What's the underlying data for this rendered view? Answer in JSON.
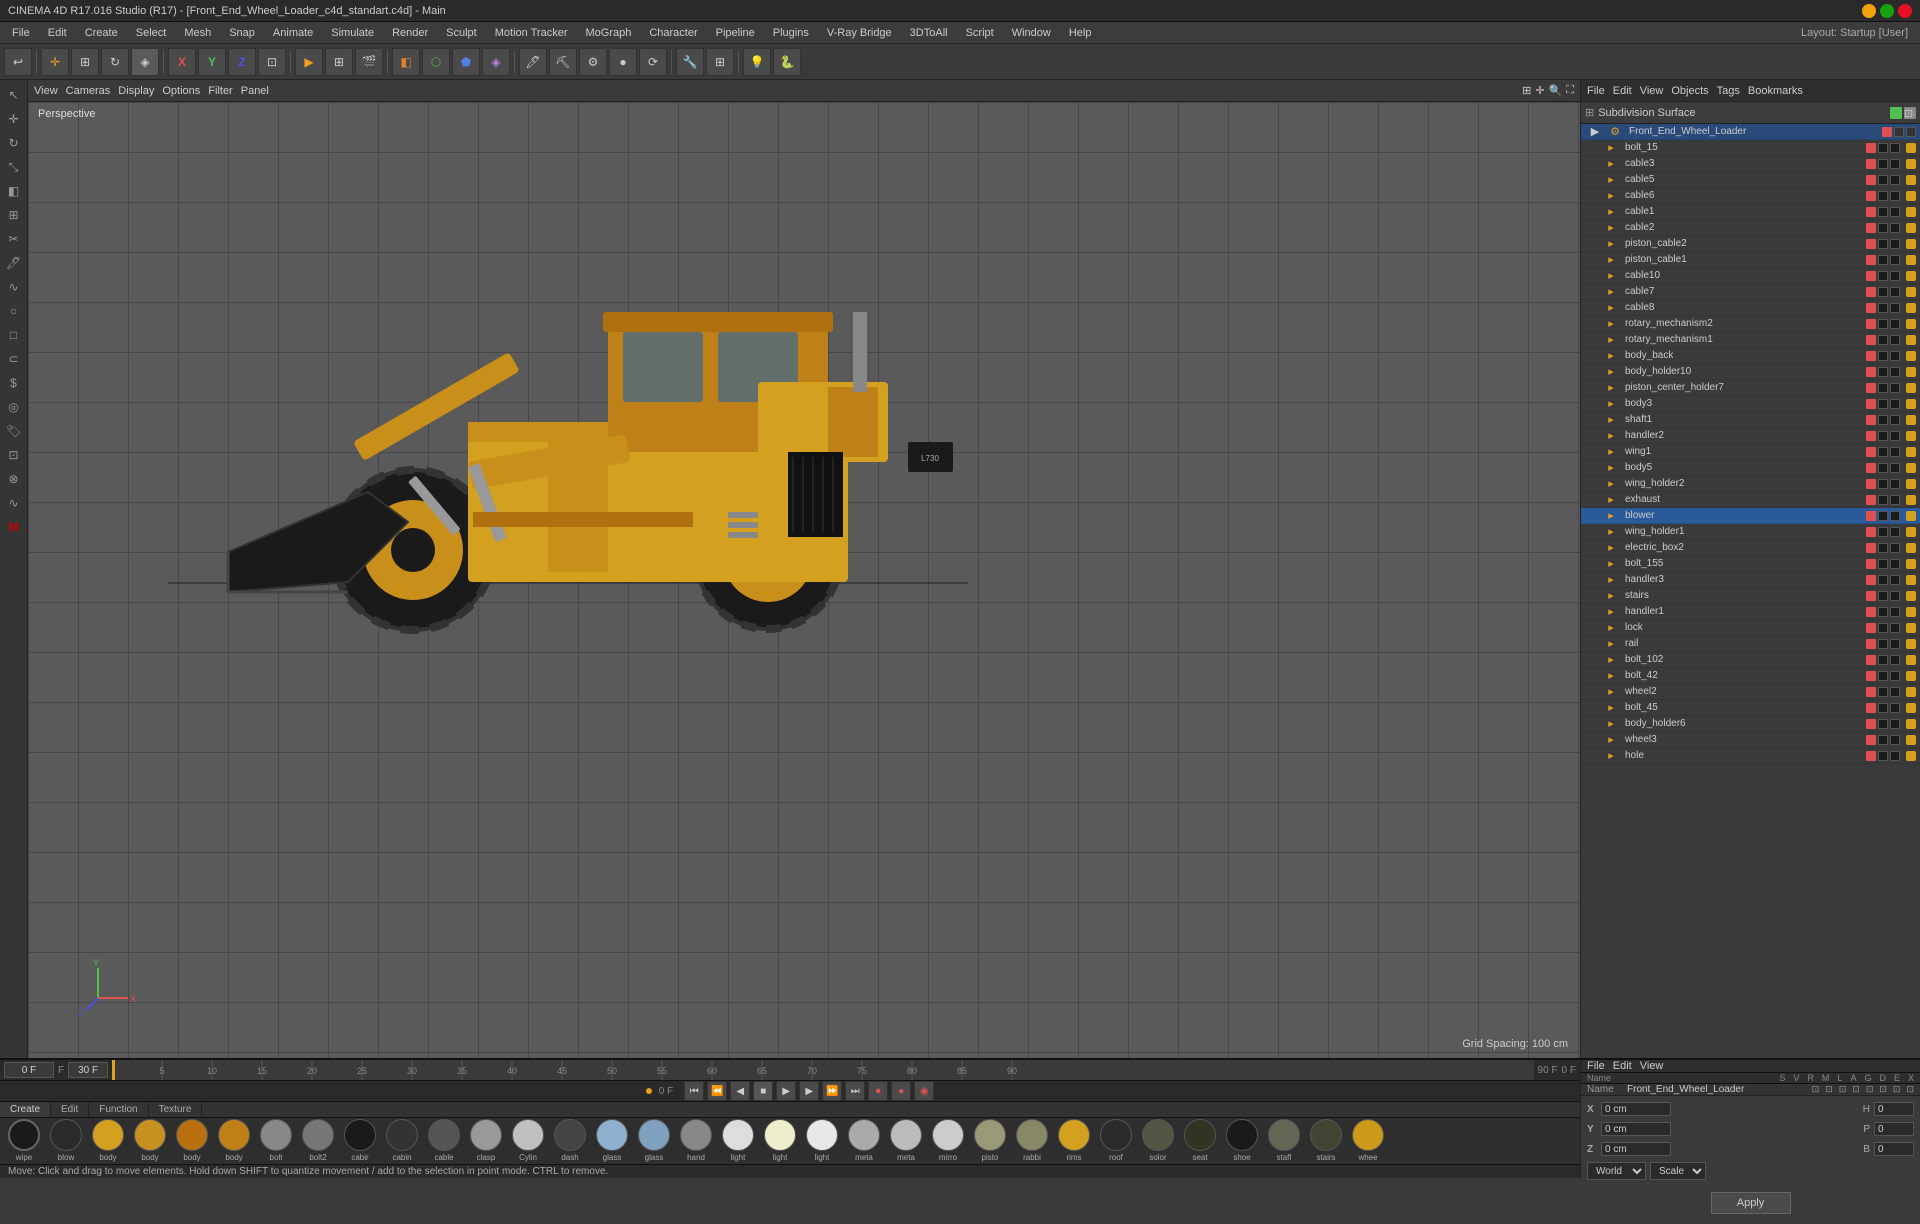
{
  "title_bar": {
    "title": "CINEMA 4D R17.016 Studio (R17) - [Front_End_Wheel_Loader_c4d_standart.c4d] - Main",
    "layout_label": "Layout: Startup [User]"
  },
  "menu_bar": {
    "items": [
      "File",
      "Edit",
      "Create",
      "Select",
      "Mesh",
      "Snap",
      "Animate",
      "Simulate",
      "Render",
      "Sculpt",
      "Motion Tracker",
      "MoGraph",
      "Character",
      "Pipeline",
      "Plugins",
      "V-Ray Bridge",
      "3DToAll",
      "Script",
      "Window",
      "Help"
    ]
  },
  "viewport": {
    "perspective_label": "Perspective",
    "grid_spacing": "Grid Spacing: 100 cm",
    "view_menus": [
      "View",
      "Cameras",
      "Display",
      "Options",
      "Filter",
      "Panel"
    ],
    "corner_icons": [
      "expand",
      "move",
      "zoom",
      "rotate"
    ]
  },
  "object_manager": {
    "header_menus": [
      "File",
      "Edit",
      "View",
      "Objects",
      "Tags",
      "Bookmarks"
    ],
    "subdivision_label": "Subdivision Surface",
    "root_object": "Front_End_Wheel_Loader",
    "objects": [
      {
        "name": "bolt_15",
        "indent": 1
      },
      {
        "name": "cable3",
        "indent": 1
      },
      {
        "name": "cable5",
        "indent": 1
      },
      {
        "name": "cable6",
        "indent": 1
      },
      {
        "name": "cable1",
        "indent": 1
      },
      {
        "name": "cable2",
        "indent": 1
      },
      {
        "name": "piston_cable2",
        "indent": 1
      },
      {
        "name": "piston_cable1",
        "indent": 1
      },
      {
        "name": "cable10",
        "indent": 1
      },
      {
        "name": "cable7",
        "indent": 1
      },
      {
        "name": "cable8",
        "indent": 1
      },
      {
        "name": "rotary_mechanism2",
        "indent": 1
      },
      {
        "name": "rotary_mechanism1",
        "indent": 1
      },
      {
        "name": "body_back",
        "indent": 1
      },
      {
        "name": "body_holder10",
        "indent": 1
      },
      {
        "name": "piston_center_holder7",
        "indent": 1
      },
      {
        "name": "body3",
        "indent": 1
      },
      {
        "name": "shaft1",
        "indent": 1
      },
      {
        "name": "handler2",
        "indent": 1
      },
      {
        "name": "wing1",
        "indent": 1
      },
      {
        "name": "body5",
        "indent": 1
      },
      {
        "name": "wing_holder2",
        "indent": 1
      },
      {
        "name": "exhaust",
        "indent": 1
      },
      {
        "name": "blower",
        "indent": 1,
        "selected": true
      },
      {
        "name": "wing_holder1",
        "indent": 1
      },
      {
        "name": "electric_box2",
        "indent": 1
      },
      {
        "name": "bolt_155",
        "indent": 1
      },
      {
        "name": "handler3",
        "indent": 1
      },
      {
        "name": "stairs",
        "indent": 1
      },
      {
        "name": "handler1",
        "indent": 1
      },
      {
        "name": "lock",
        "indent": 1
      },
      {
        "name": "rail",
        "indent": 1
      },
      {
        "name": "bolt_102",
        "indent": 1
      },
      {
        "name": "bolt_42",
        "indent": 1
      },
      {
        "name": "wheel2",
        "indent": 1
      },
      {
        "name": "bolt_45",
        "indent": 1
      },
      {
        "name": "body_holder6",
        "indent": 1
      },
      {
        "name": "wheel3",
        "indent": 1
      },
      {
        "name": "hole",
        "indent": 1
      }
    ]
  },
  "attributes_panel": {
    "header_menus": [
      "File",
      "Edit",
      "View"
    ],
    "name_label": "Name",
    "object_name": "Front_End_Wheel_Loader",
    "coord_labels": {
      "x": "X",
      "y": "Y",
      "z": "Z"
    },
    "coord_values": {
      "x": "0 cm",
      "y": "0 cm",
      "z": "0 cm"
    },
    "h_label": "H",
    "p_label": "P",
    "b_label": "B",
    "h_value": "0",
    "p_value": "0",
    "b_value": "0",
    "mode_world": "World",
    "mode_scale": "Scale",
    "apply_label": "Apply",
    "column_headers": [
      "S",
      "V",
      "R",
      "M",
      "L",
      "A",
      "G",
      "D",
      "E",
      "X"
    ]
  },
  "materials": [
    {
      "label": "blow",
      "color": "#2a2a2a",
      "type": "dark"
    },
    {
      "label": "body",
      "color": "#d4a020",
      "type": "gold"
    },
    {
      "label": "body",
      "color": "#c89020",
      "type": "gold2"
    },
    {
      "label": "body",
      "color": "#b87010",
      "type": "gold3"
    },
    {
      "label": "body",
      "color": "#c08018",
      "type": "gold4"
    },
    {
      "label": "bolt",
      "color": "#888888",
      "type": "grey"
    },
    {
      "label": "bolt2",
      "color": "#777777",
      "type": "grey2"
    },
    {
      "label": "cabir",
      "color": "#1a1a1a",
      "type": "black"
    },
    {
      "label": "cabin",
      "color": "#333333",
      "type": "darkgrey"
    },
    {
      "label": "cable",
      "color": "#555555",
      "type": "midgrey"
    },
    {
      "label": "clasp",
      "color": "#999999",
      "type": "lightgrey"
    },
    {
      "label": "Cylin",
      "color": "#c0c0c0",
      "type": "silver"
    },
    {
      "label": "dash",
      "color": "#444444",
      "type": "dark2"
    },
    {
      "label": "glass",
      "color": "#90b0d0",
      "type": "blue"
    },
    {
      "label": "glass",
      "color": "#80a0c0",
      "type": "blue2"
    },
    {
      "label": "hand",
      "color": "#888888",
      "type": "grey3"
    },
    {
      "label": "light",
      "color": "#dddddd",
      "type": "white"
    },
    {
      "label": "light",
      "color": "#eeeecc",
      "type": "cream"
    },
    {
      "label": "light",
      "color": "#e8e8e8",
      "type": "white2"
    },
    {
      "label": "meta",
      "color": "#aaaaaa",
      "type": "metal"
    },
    {
      "label": "meta",
      "color": "#bbbbbb",
      "type": "metal2"
    },
    {
      "label": "mirro",
      "color": "#cccccc",
      "type": "mirror"
    },
    {
      "label": "pisto",
      "color": "#999977",
      "type": "pistn"
    },
    {
      "label": "rabbi",
      "color": "#888866",
      "type": "rabb"
    },
    {
      "label": "rims",
      "color": "#d4a020",
      "type": "rims"
    },
    {
      "label": "roof",
      "color": "#2a2a2a",
      "type": "roof"
    },
    {
      "label": "solor",
      "color": "#555544",
      "type": "solar"
    },
    {
      "label": "seat",
      "color": "#333322",
      "type": "seat"
    },
    {
      "label": "shoe",
      "color": "#1a1a18",
      "type": "shoe"
    },
    {
      "label": "staff",
      "color": "#666655",
      "type": "staff"
    },
    {
      "label": "stairs",
      "color": "#444433",
      "type": "stairs"
    },
    {
      "label": "whee",
      "color": "#cc9918",
      "type": "wheel"
    }
  ],
  "timeline": {
    "frame_start": "0 F",
    "frame_end": "90 F",
    "fps": "30 F",
    "current": "0 F",
    "marks": [
      0,
      5,
      10,
      15,
      20,
      25,
      30,
      35,
      40,
      45,
      50,
      55,
      60,
      65,
      70,
      75,
      80,
      85,
      90
    ]
  },
  "status_bar": {
    "message": "Move: Click and drag to move elements. Hold down SHIFT to quantize movement / add to the selection in point mode. CTRL to remove."
  },
  "wipe": {
    "label": "wipe"
  }
}
